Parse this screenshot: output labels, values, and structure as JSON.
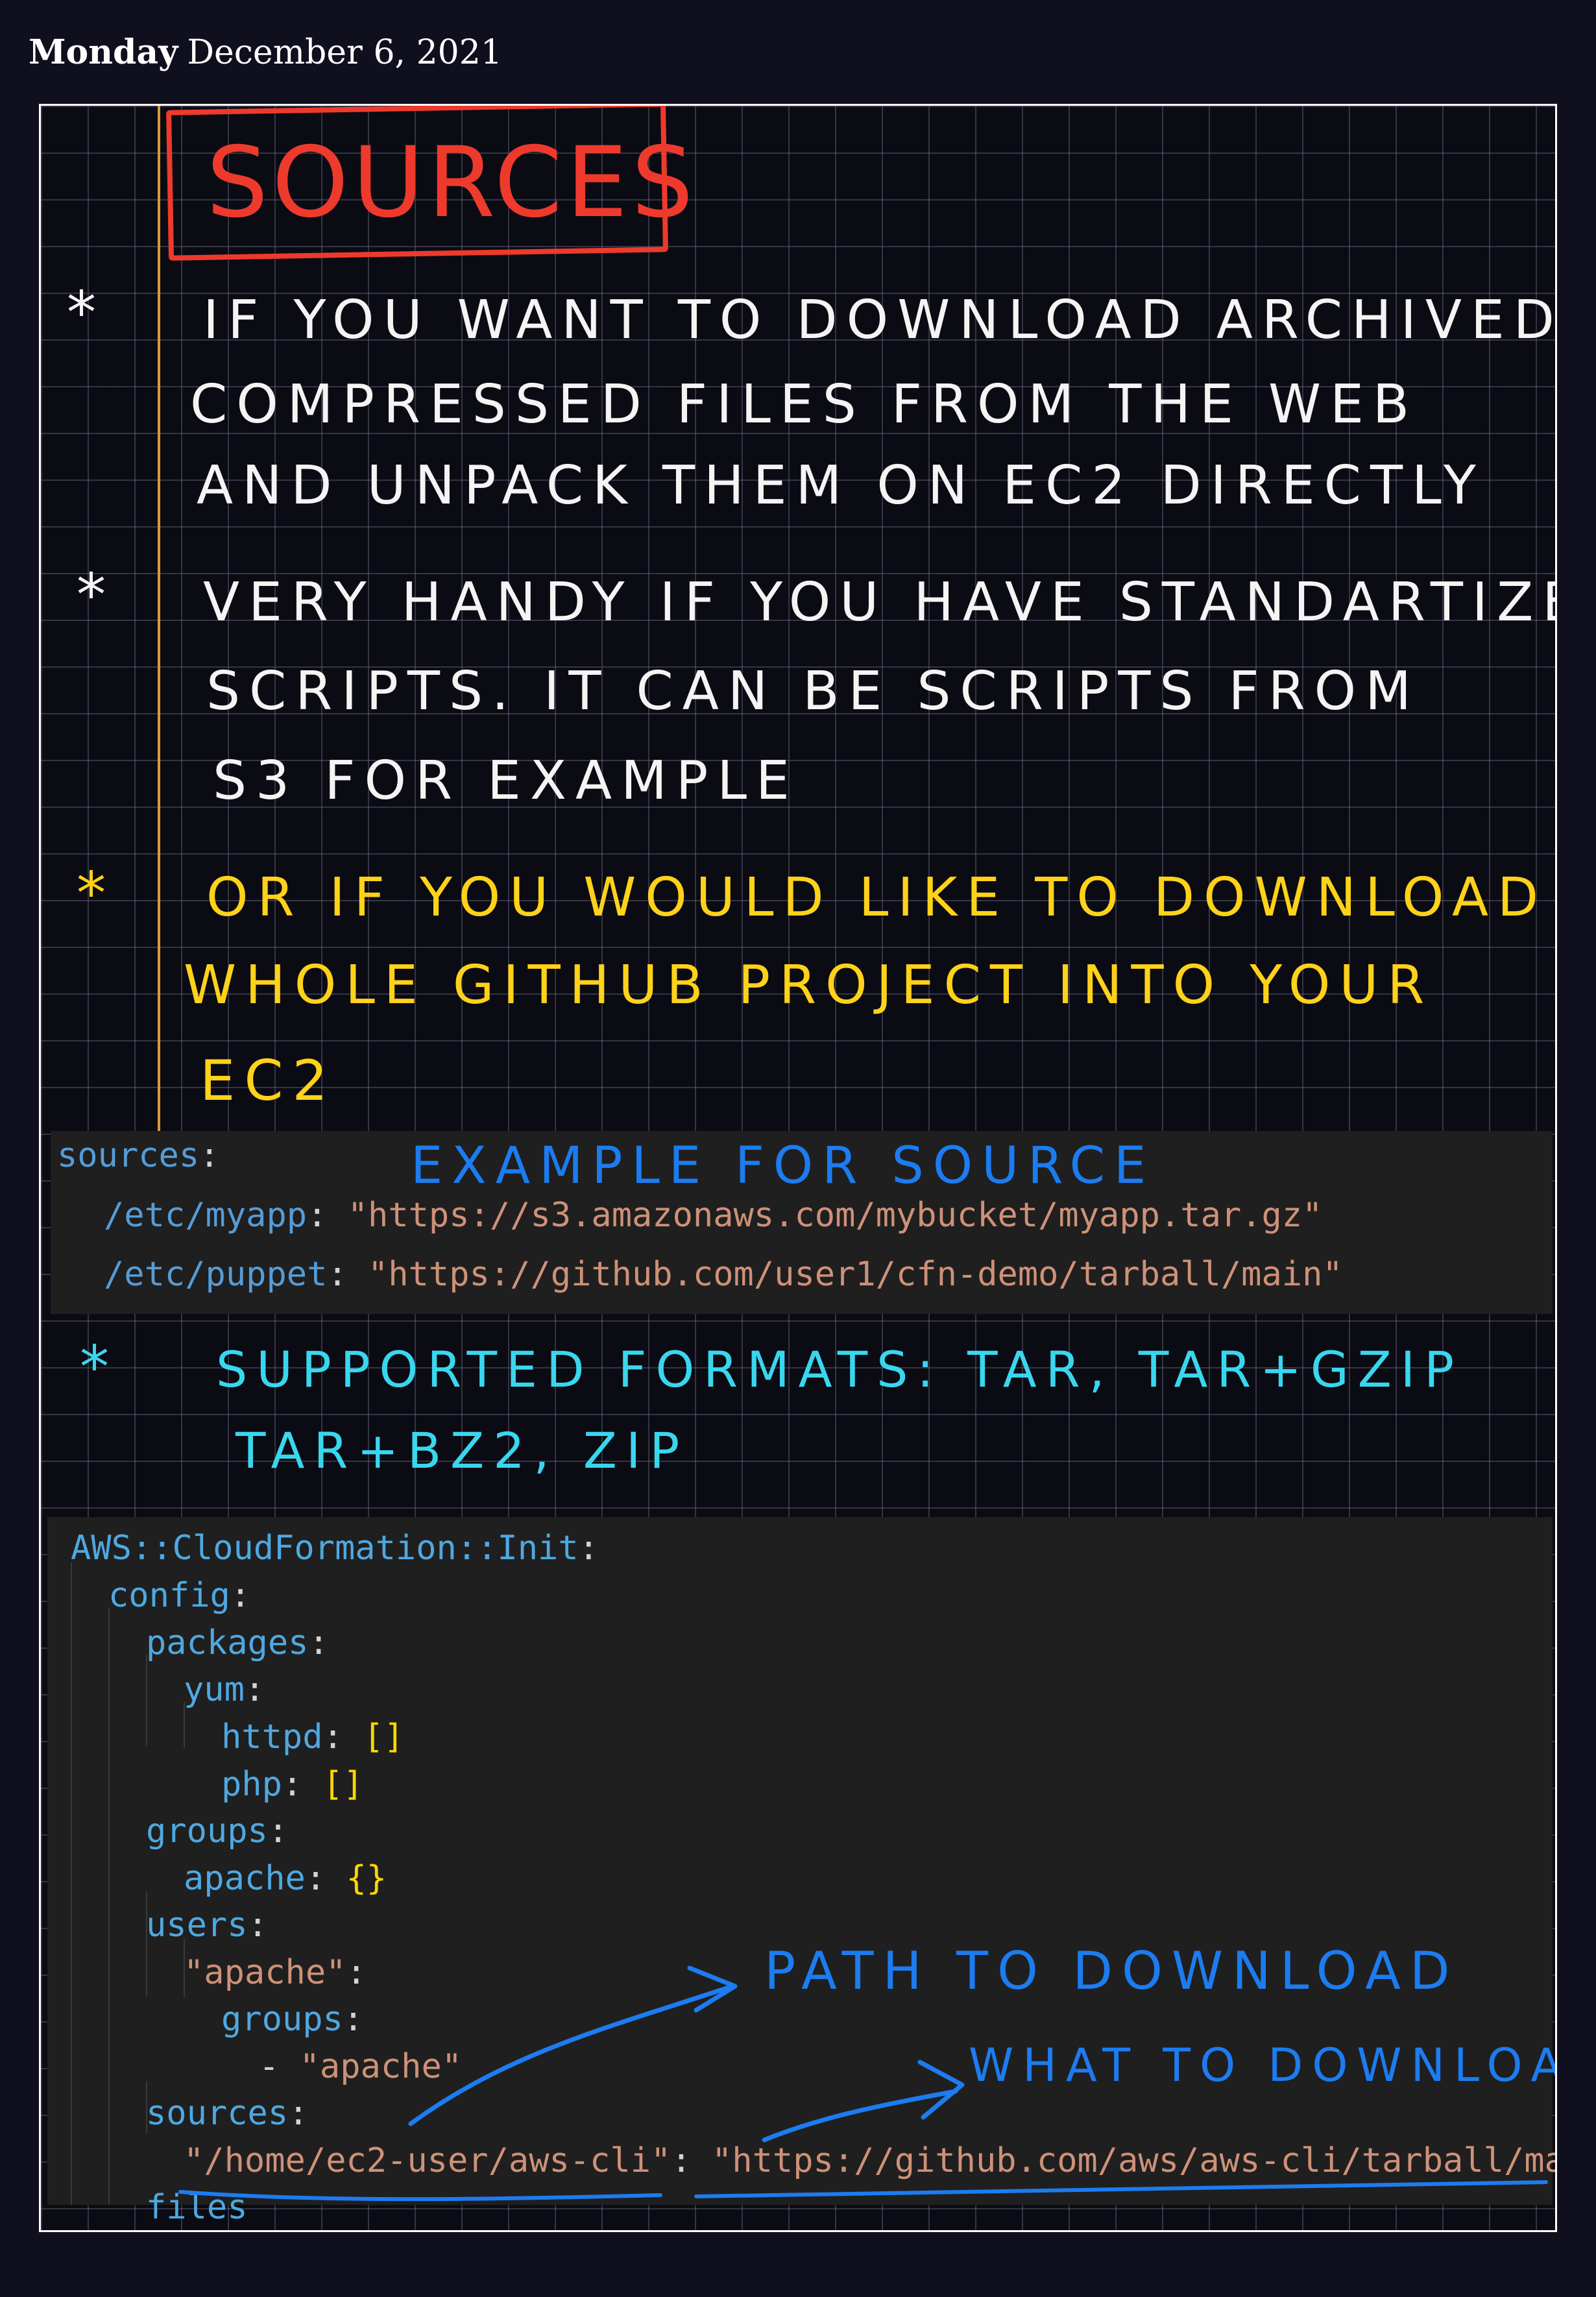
{
  "header": {
    "day": "Monday",
    "date": "December 6, 2021"
  },
  "note": {
    "title": "SOURCES",
    "bullets": [
      {
        "symbol": "*",
        "lines": [
          "IF YOU WANT TO DOWNLOAD ARCHIVED",
          "COMPRESSED FILES FROM THE WEB",
          "AND UNPACK THEM ON EC2 DIRECTLY"
        ]
      },
      {
        "symbol": "*",
        "lines": [
          "VERY HANDY IF YOU HAVE STANDARTIZE",
          "SCRIPTS. IT CAN BE SCRIPTS FROM",
          "S3 FOR EXAMPLE"
        ]
      },
      {
        "symbol": "*",
        "lines": [
          "OR IF YOU WOULD LIKE TO DOWNLOAD",
          "WHOLE GITHUB PROJECT INTO YOUR",
          "EC2"
        ]
      },
      {
        "symbol": "*",
        "lines": [
          "SUPPORTED FORMATS: TAR, TAR+GZIP",
          "TAR+BZ2, ZIP"
        ]
      }
    ],
    "annotations": {
      "example": "EXAMPLE FOR SOURCE",
      "path": "PATH TO DOWNLOAD",
      "what": "WHAT TO DOWNLOAD"
    }
  },
  "code_example": {
    "l1": {
      "key": "sources",
      "punct": ":"
    },
    "l2": {
      "key": "/etc/myapp",
      "punct": ": ",
      "value": "\"https://s3.amazonaws.com/mybucket/myapp.tar.gz\""
    },
    "l3": {
      "key": "/etc/puppet",
      "punct": ": ",
      "value": "\"https://github.com/user1/cfn-demo/tarball/main\""
    }
  },
  "code_config": {
    "l1": {
      "key": "AWS::CloudFormation::Init",
      "punct": ":"
    },
    "l2": {
      "key": "config",
      "punct": ":"
    },
    "l3": {
      "key": "packages",
      "punct": ":"
    },
    "l4": {
      "key": "yum",
      "punct": ":"
    },
    "l5": {
      "key": "httpd",
      "punct": ": ",
      "value": "[]"
    },
    "l6": {
      "key": "php",
      "punct": ": ",
      "value": "[]"
    },
    "l7": {
      "key": "groups",
      "punct": ":"
    },
    "l8": {
      "key": "apache",
      "punct": ": ",
      "value": "{}"
    },
    "l9": {
      "key": "users",
      "punct": ":"
    },
    "l10": {
      "key": "\"apache\"",
      "punct": ":"
    },
    "l11": {
      "key": "groups",
      "punct": ":"
    },
    "l12": {
      "dash": "- ",
      "value": "\"apache\""
    },
    "l13": {
      "key": "sources",
      "punct": ":"
    },
    "l14": {
      "key": "\"/home/ec2-user/aws-cli\"",
      "punct": ": ",
      "value": "\"https://github.com/aws/aws-cli/tarball/master\""
    },
    "l15": {
      "key": "files"
    }
  },
  "colors": {
    "white_ink": "#f4f4f4",
    "yellow_ink": "#ffd21a",
    "cyan_ink": "#39d7ee",
    "blue_ink": "#1c7cf0",
    "red_ink": "#ee3a2c"
  }
}
